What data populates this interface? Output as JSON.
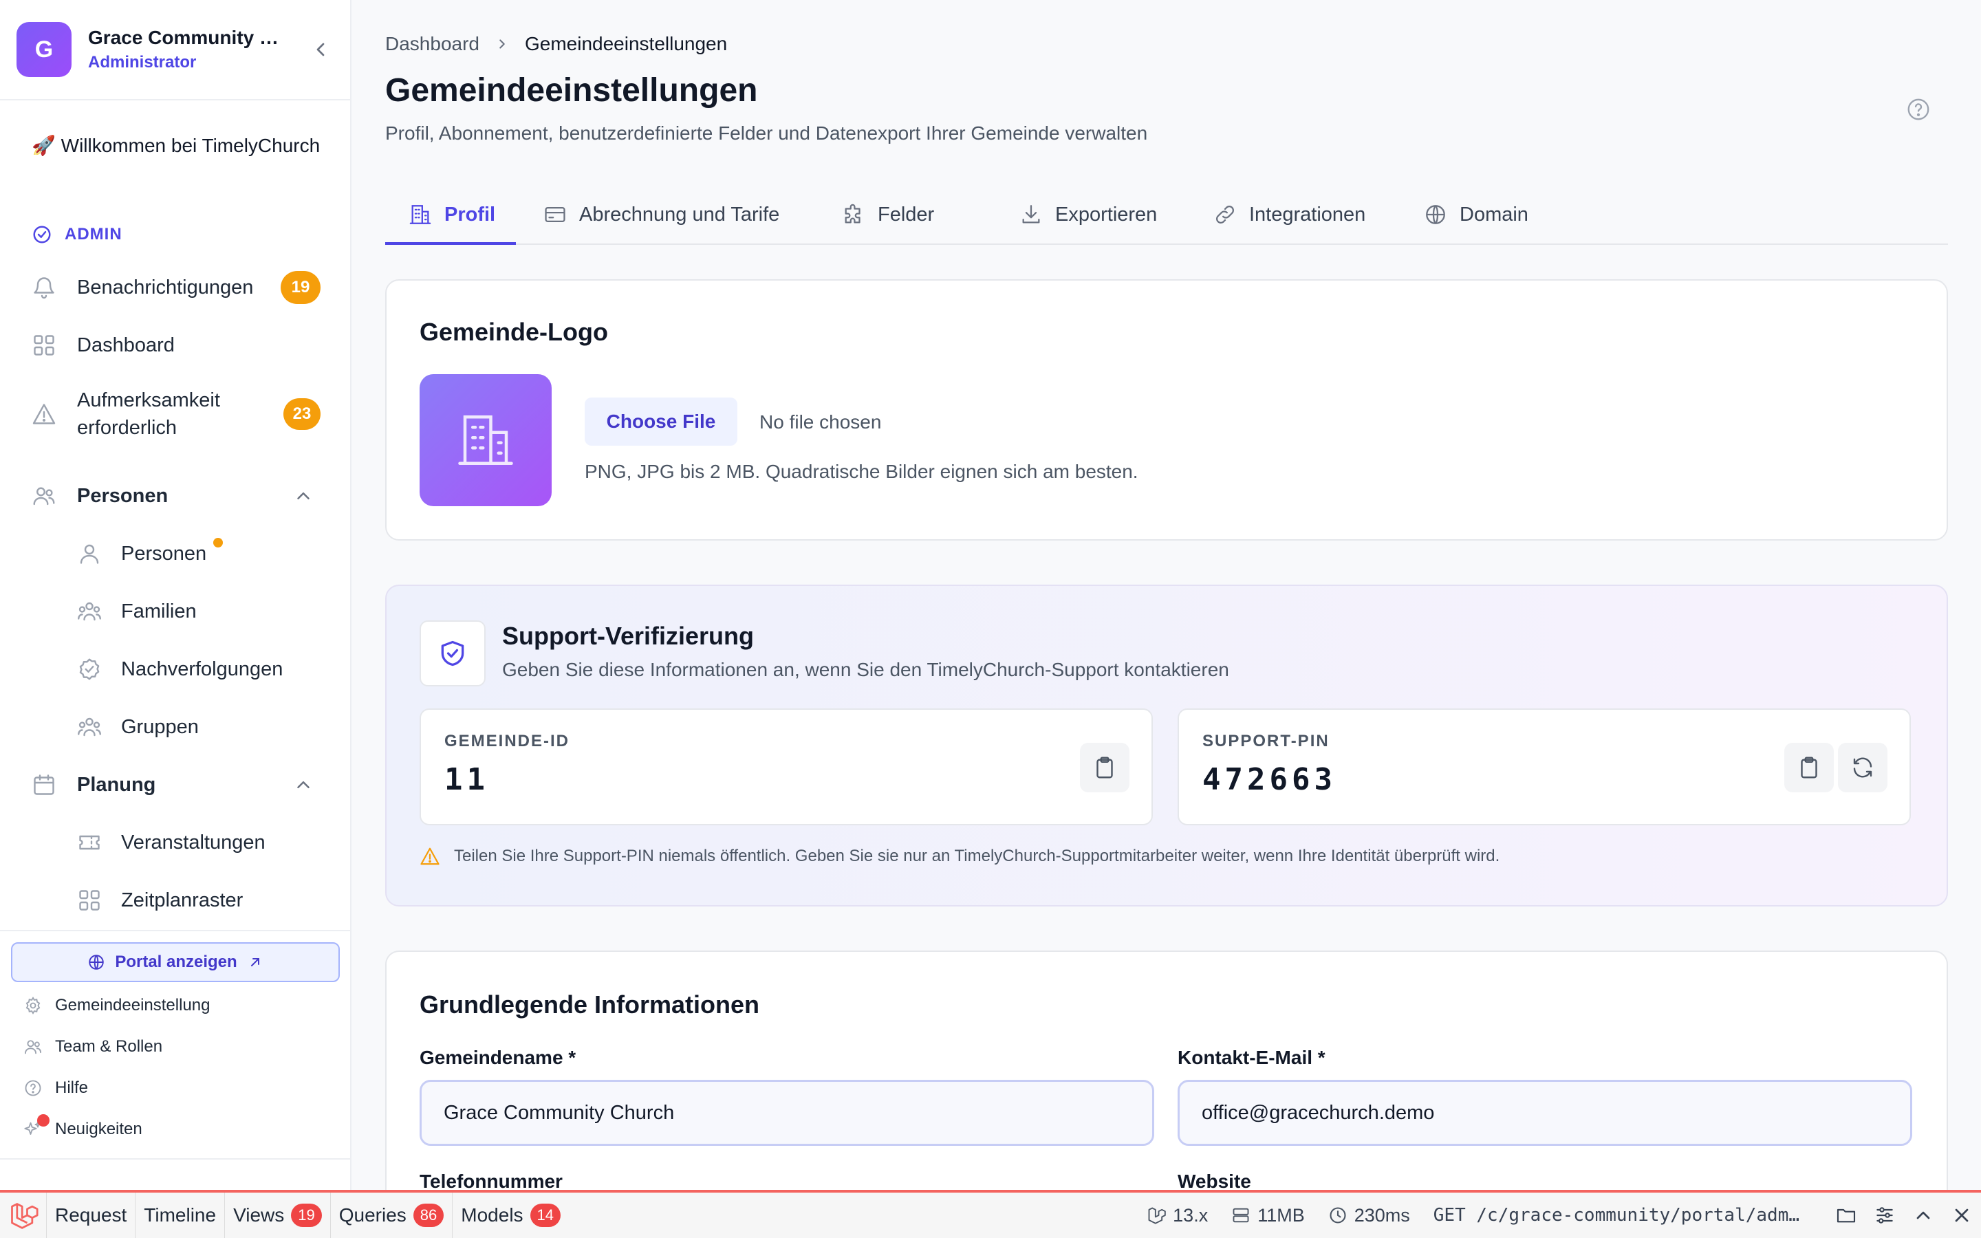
{
  "sidebar": {
    "avatar_letter": "G",
    "church_name": "Grace Community Church",
    "role": "Administrator",
    "welcome": "🚀 Willkommen bei TimelyChurch",
    "section_label": "ADMIN",
    "items": {
      "notifications": {
        "label": "Benachrichtigungen",
        "badge": "19"
      },
      "dashboard": {
        "label": "Dashboard"
      },
      "attention": {
        "label": "Aufmerksamkeit erforderlich",
        "badge": "23"
      },
      "people_group": {
        "label": "Personen"
      },
      "people": {
        "label": "Personen"
      },
      "families": {
        "label": "Familien"
      },
      "followups": {
        "label": "Nachverfolgungen"
      },
      "groups": {
        "label": "Gruppen"
      },
      "planning_group": {
        "label": "Planung"
      },
      "events": {
        "label": "Veranstaltungen"
      },
      "schedule": {
        "label": "Zeitplanraster"
      }
    },
    "portal_button": "Portal anzeigen",
    "footer": {
      "settings": "Gemeindeeinstellung",
      "team": "Team & Rollen",
      "help": "Hilfe",
      "news": "Neuigkeiten"
    }
  },
  "breadcrumb": {
    "home": "Dashboard",
    "current": "Gemeindeeinstellungen"
  },
  "page": {
    "title": "Gemeindeeinstellungen",
    "subtitle": "Profil, Abonnement, benutzerdefinierte Felder und Datenexport Ihrer Gemeinde verwalten"
  },
  "tabs": {
    "profile": "Profil",
    "billing": "Abrechnung und Tarife",
    "fields": "Felder",
    "export": "Exportieren",
    "integrations": "Integrationen",
    "domain": "Domain"
  },
  "logo_card": {
    "title": "Gemeinde-Logo",
    "choose_file": "Choose File",
    "no_file": "No file chosen",
    "hint": "PNG, JPG bis 2 MB. Quadratische Bilder eignen sich am besten."
  },
  "support": {
    "title": "Support-Verifizierung",
    "subtitle": "Geben Sie diese Informationen an, wenn Sie den TimelyChurch-Support kontaktieren",
    "church_id_label": "GEMEINDE-ID",
    "church_id": "11",
    "pin_label": "SUPPORT-PIN",
    "pin": "472663",
    "warning": "Teilen Sie Ihre Support-PIN niemals öffentlich. Geben Sie sie nur an TimelyChurch-Supportmitarbeiter weiter, wenn Ihre Identität überprüft wird."
  },
  "basic_info": {
    "title": "Grundlegende Informationen",
    "name_label": "Gemeindename *",
    "name_value": "Grace Community Church",
    "email_label": "Kontakt-E-Mail *",
    "email_value": "office@gracechurch.demo",
    "phone_label": "Telefonnummer",
    "website_label": "Website"
  },
  "debugbar": {
    "request": "Request",
    "timeline": "Timeline",
    "views": "Views",
    "views_count": "19",
    "queries": "Queries",
    "queries_count": "86",
    "models": "Models",
    "models_count": "14",
    "version": "13.x",
    "memory": "11MB",
    "duration": "230ms",
    "url": "GET /c/grace-community/portal/adm…"
  },
  "colors": {
    "accent": "#4f46e5",
    "badge": "#f59e0b",
    "debug_red": "#ef4444"
  }
}
